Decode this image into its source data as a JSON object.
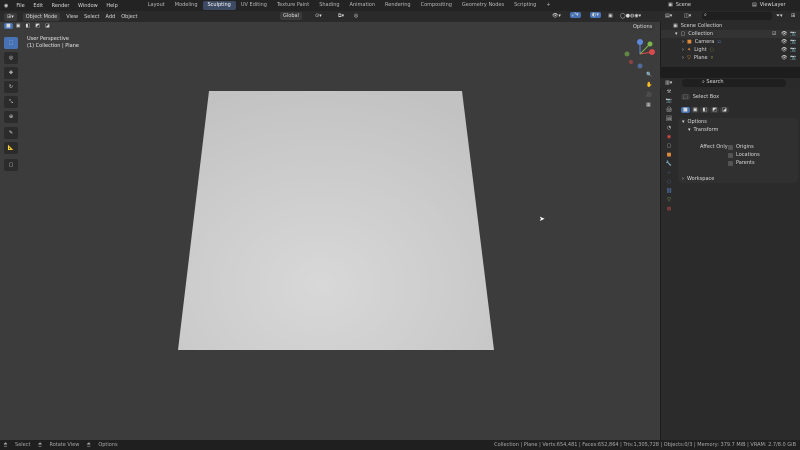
{
  "topbar": {
    "menus": [
      "File",
      "Edit",
      "Render",
      "Window",
      "Help"
    ],
    "workspaces": [
      "Layout",
      "Modeling",
      "Sculpting",
      "UV Editing",
      "Texture Paint",
      "Shading",
      "Animation",
      "Rendering",
      "Compositing",
      "Geometry Nodes",
      "Scripting"
    ],
    "active_workspace": "Sculpting",
    "scene": "Scene",
    "viewlayer": "ViewLayer"
  },
  "viewport_header": {
    "mode": "Object Mode",
    "menus": [
      "View",
      "Select",
      "Add",
      "Object"
    ],
    "orientation": "Global",
    "options": "Options"
  },
  "viewport": {
    "perspective": "User Perspective",
    "context": "(1) Collection | Plane"
  },
  "outliner": {
    "search_placeholder": "",
    "root": "Scene Collection",
    "collection": "Collection",
    "items": [
      "Camera",
      "Light",
      "Plane"
    ]
  },
  "properties": {
    "tool": "Select Box",
    "options": "Options",
    "transform": "Transform",
    "affect_only": "Affect Only",
    "affect_items": [
      "Origins",
      "Locations",
      "Parents"
    ],
    "workspace": "Workspace"
  },
  "status": {
    "select": "Select",
    "rotate": "Rotate View",
    "options": "Options",
    "stats": "Collection | Plane | Verts:654,481 | Faces:652,864 | Tris:1,305,728 | Objects:0/3 | Memory: 379.7 MiB | VRAM: 2.7/8.0 GiB"
  },
  "colors": {
    "accent": "#4772b3",
    "viewport": "#3c3c3c",
    "plane": "#cfcfcf"
  }
}
